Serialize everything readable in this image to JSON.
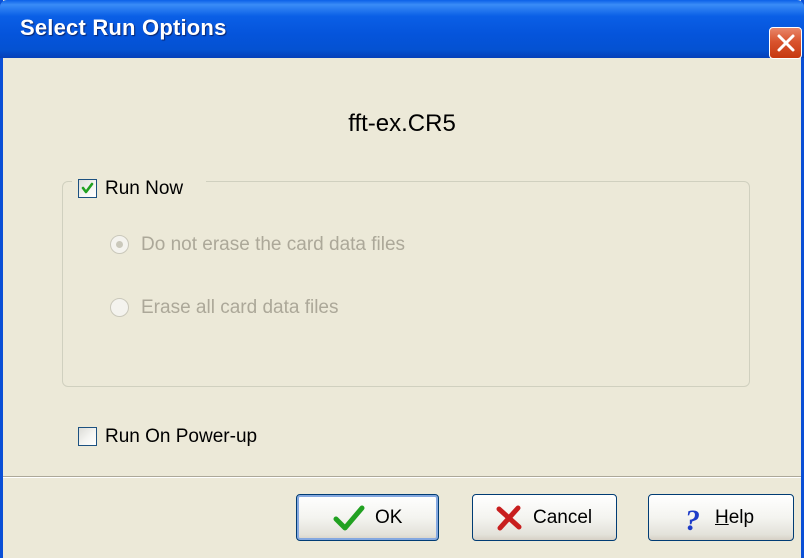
{
  "window": {
    "title": "Select Run Options",
    "close_icon": "close-icon"
  },
  "filename": "fft-ex.CR5",
  "run_now": {
    "label": "Run Now",
    "checked": true,
    "options": [
      {
        "label": "Do not erase the card data files",
        "selected": true,
        "enabled": false
      },
      {
        "label": "Erase all card data files",
        "selected": false,
        "enabled": false
      }
    ]
  },
  "run_on_powerup": {
    "label": "Run On Power-up",
    "checked": false
  },
  "buttons": {
    "ok": {
      "label": "OK",
      "icon": "checkmark-icon"
    },
    "cancel": {
      "label": "Cancel",
      "icon": "x-icon"
    },
    "help": {
      "label_underlined": "H",
      "label_rest": "elp",
      "icon": "question-mark-icon"
    }
  },
  "colors": {
    "titlebar": "#0554DB",
    "window_bg": "#ECE9D8",
    "check_green": "#21A121",
    "cancel_red": "#C81E1E",
    "help_blue": "#1E3CC8"
  }
}
